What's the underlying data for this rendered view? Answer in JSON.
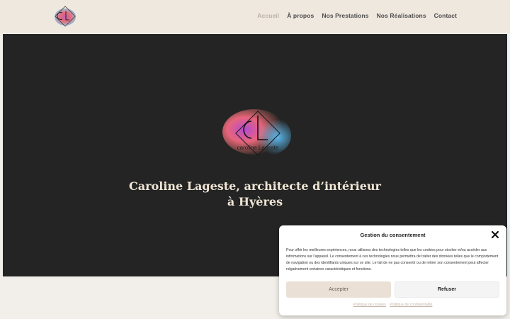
{
  "nav": {
    "items": [
      {
        "label": "Accueil",
        "active": true
      },
      {
        "label": "À propos",
        "active": false
      },
      {
        "label": "Nos Prestations",
        "active": false
      },
      {
        "label": "Nos Réalisations",
        "active": false
      },
      {
        "label": "Contact",
        "active": false
      }
    ]
  },
  "hero": {
    "title_line1": "Caroline Lageste, architecte d’intérieur",
    "title_line2": "à Hyères",
    "logo_monogram": "CL",
    "logo_text": "caroline Lageste"
  },
  "consent": {
    "title": "Gestion du consentement",
    "body": "Pour offrir les meilleures expériences, nous utilisons des technologies telles que les cookies pour stocker et/ou accéder aux informations sur l’appareil. Le consentement à ces technologies nous permettra de traiter des données telles que le comportement de navigation ou des identifiants uniques sur ce site. Le fait de ne pas consentir ou de retirer son consentement peut affecter négativement certaines caractéristiques et fonctions.",
    "accept_label": "Accepter",
    "refuse_label": "Refuser",
    "cookie_policy": "Politique de cookies",
    "privacy_policy": "Politique de confidentialité"
  },
  "colors": {
    "header_bg": "#efe8df",
    "hero_bg": "#242424",
    "hero_title": "#efe5d6",
    "accept_bg": "#eae0d6"
  }
}
